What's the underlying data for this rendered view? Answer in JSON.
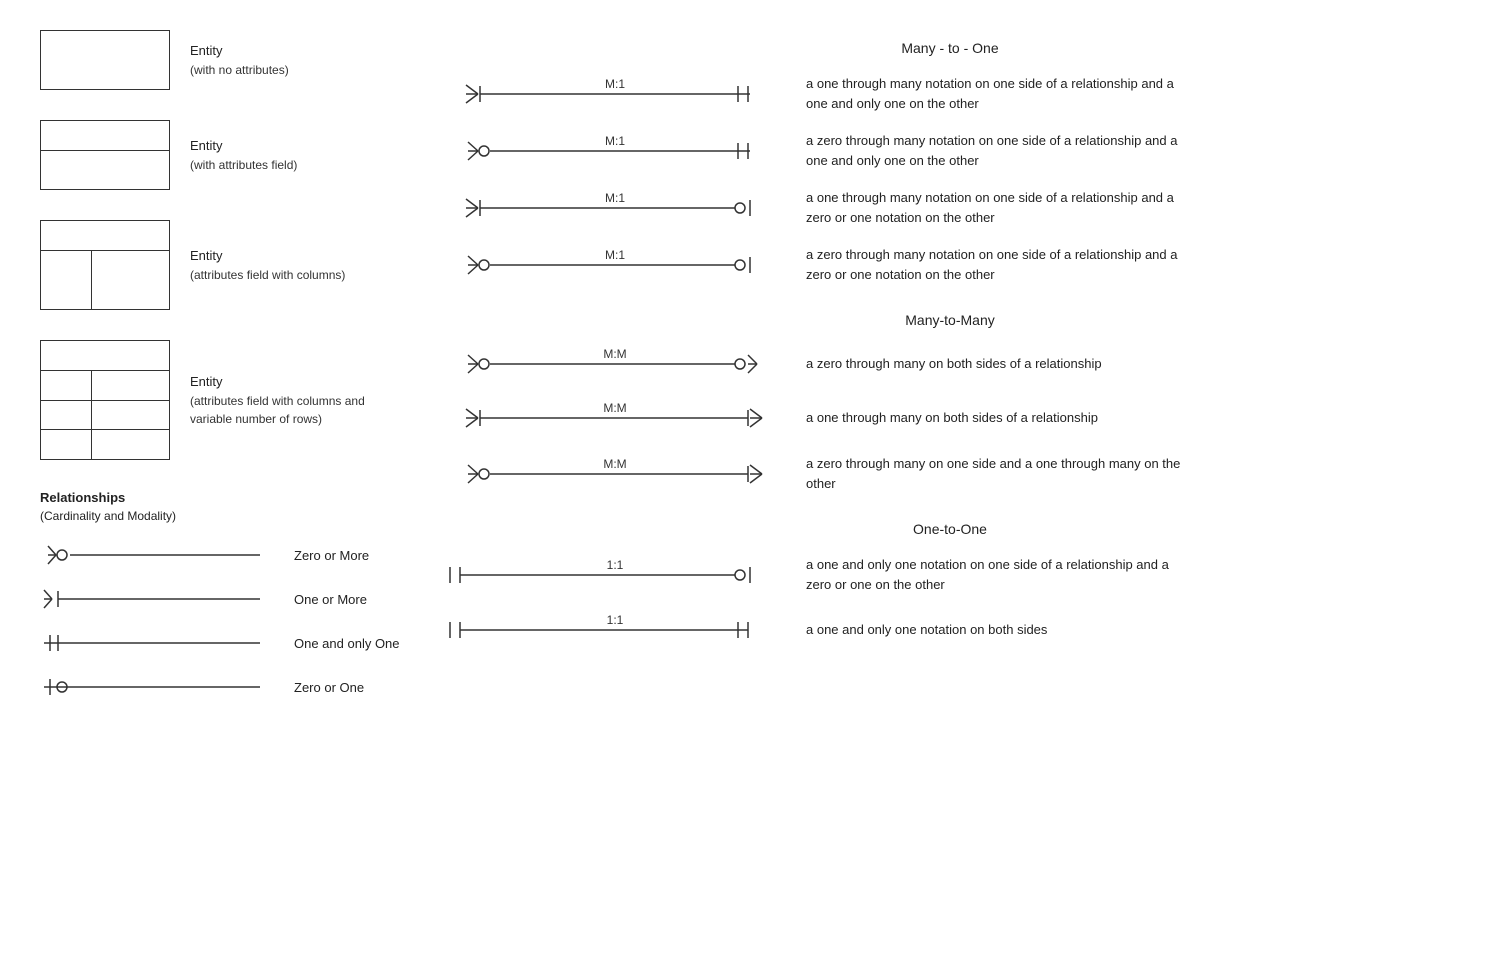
{
  "entities": [
    {
      "id": "entity-simple",
      "type": "simple",
      "label": "Entity",
      "sublabel": "(with no attributes)"
    },
    {
      "id": "entity-attr",
      "type": "with-attr",
      "label": "Entity",
      "sublabel": "(with attributes field)"
    },
    {
      "id": "entity-columns",
      "type": "with-columns",
      "label": "Entity",
      "sublabel": "(attributes field with columns)"
    },
    {
      "id": "entity-rows",
      "type": "with-rows",
      "label": "Entity",
      "sublabel": "(attributes field with columns and\nvariable number of rows)"
    }
  ],
  "relationships_title": "Relationships",
  "relationships_subtitle": "(Cardinality and Modality)",
  "rel_items": [
    {
      "id": "zero-or-more",
      "label": "Zero or More",
      "symbol": "zero-through-many-left"
    },
    {
      "id": "one-or-more",
      "label": "One or More",
      "symbol": "one-through-many-left"
    },
    {
      "id": "one-and-only-one",
      "label": "One and only One",
      "symbol": "one-and-only-one-left"
    },
    {
      "id": "zero-or-one",
      "label": "Zero or One",
      "symbol": "zero-or-one-left"
    }
  ],
  "sections": [
    {
      "id": "many-to-one",
      "title": "Many - to - One",
      "diagrams": [
        {
          "id": "m1-1",
          "left": "one-through-many",
          "right": "one-and-only-one",
          "label": "M:1",
          "desc": "a one through many notation on one side of a relationship and a one and only one on the other"
        },
        {
          "id": "m1-2",
          "left": "zero-through-many",
          "right": "one-and-only-one",
          "label": "M:1",
          "desc": "a zero through many notation on one side of a relationship and a one and only one on the other"
        },
        {
          "id": "m1-3",
          "left": "one-through-many",
          "right": "zero-or-one",
          "label": "M:1",
          "desc": "a one through many notation on one side of a relationship and a zero or one notation on the other"
        },
        {
          "id": "m1-4",
          "left": "zero-through-many",
          "right": "zero-or-one",
          "label": "M:1",
          "desc": "a zero through many notation on one side of a relationship and a zero or one notation on the other"
        }
      ]
    },
    {
      "id": "many-to-many",
      "title": "Many-to-Many",
      "diagrams": [
        {
          "id": "mm-1",
          "left": "zero-through-many",
          "right": "zero-through-many-right",
          "label": "M:M",
          "desc": "a zero through many on both sides of a relationship"
        },
        {
          "id": "mm-2",
          "left": "one-through-many",
          "right": "one-through-many-right",
          "label": "M:M",
          "desc": "a one through many on both sides of a relationship"
        },
        {
          "id": "mm-3",
          "left": "zero-through-many",
          "right": "one-through-many-right",
          "label": "M:M",
          "desc": "a zero through many on one side and a one through many on the other"
        }
      ]
    },
    {
      "id": "one-to-one",
      "title": "One-to-One",
      "diagrams": [
        {
          "id": "11-1",
          "left": "one-and-only-one",
          "right": "zero-or-one",
          "label": "1:1",
          "desc": "a one and only one notation on one side of a relationship and a zero or one on the other"
        },
        {
          "id": "11-2",
          "left": "one-and-only-one",
          "right": "one-and-only-one",
          "label": "1:1",
          "desc": "a one and only one notation on both sides"
        }
      ]
    }
  ]
}
